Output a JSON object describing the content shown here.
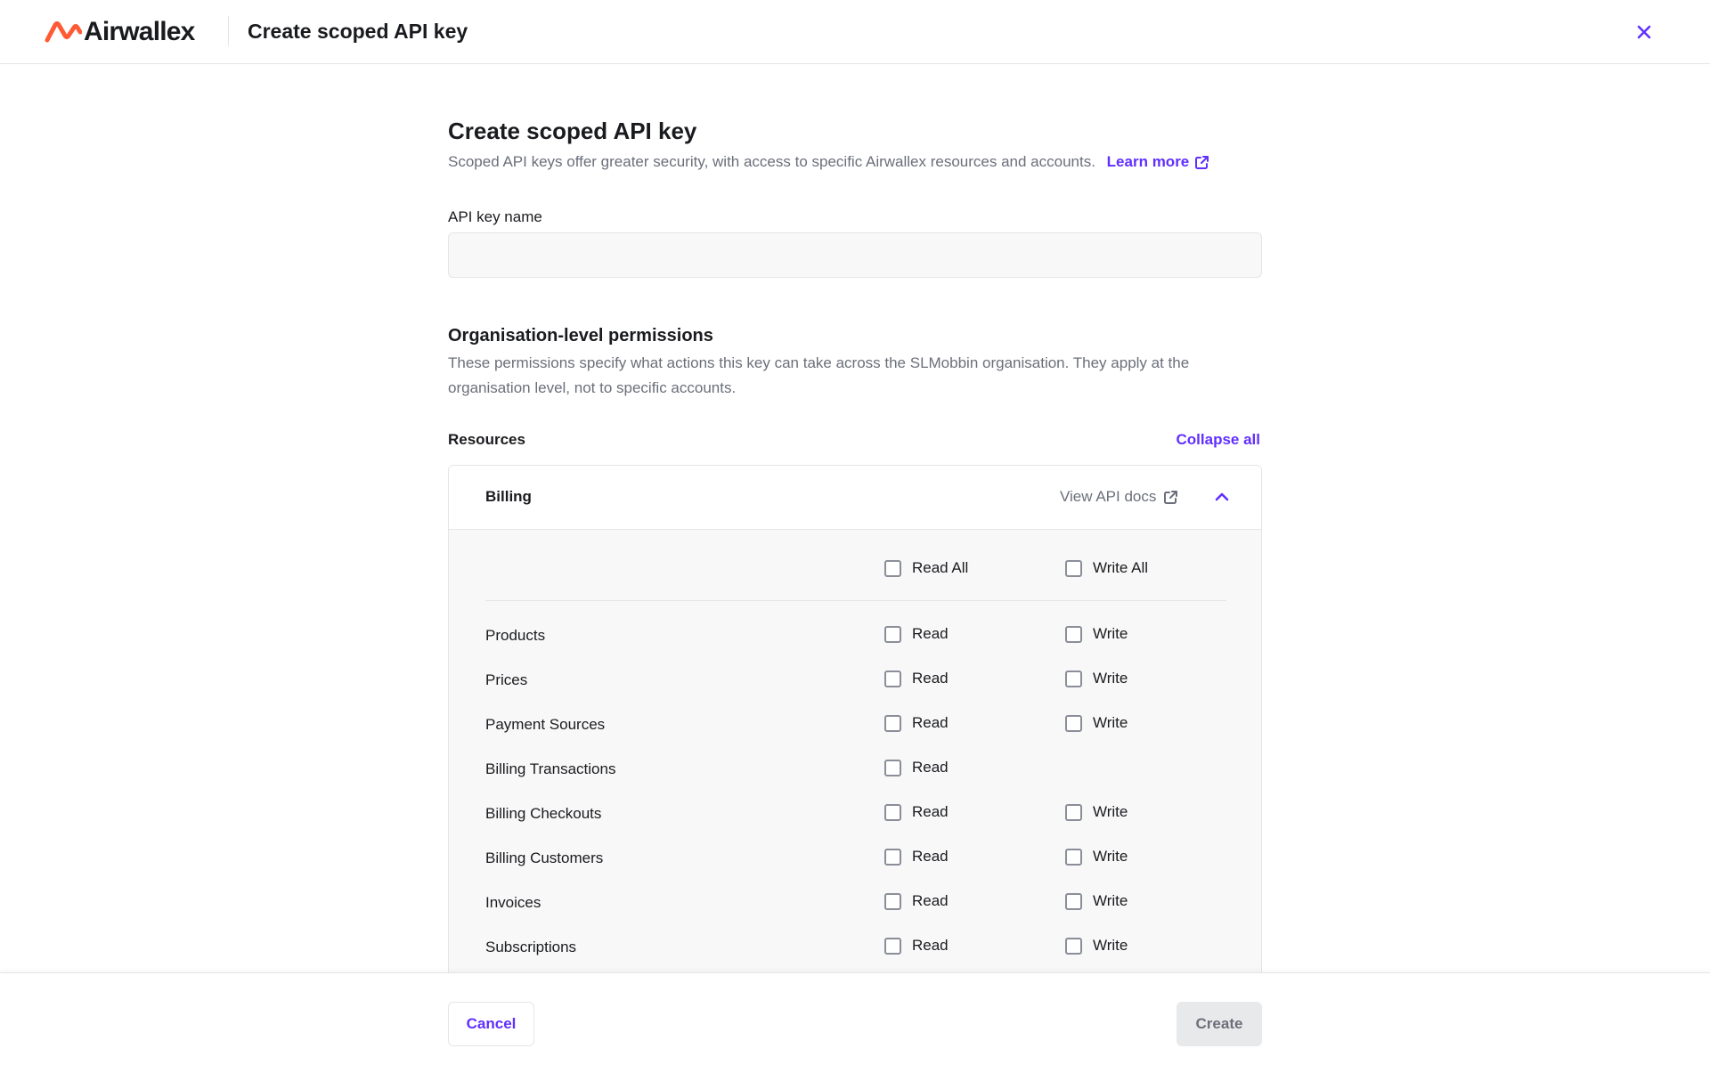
{
  "header": {
    "brand": "Airwallex",
    "title": "Create scoped API key",
    "brand_color": "#ff5a36",
    "accent_color": "#612fff"
  },
  "main": {
    "title": "Create scoped API key",
    "description": "Scoped API keys offer greater security, with access to specific Airwallex resources and accounts.",
    "learn_more": "Learn more",
    "api_key_name_label": "API key name",
    "api_key_name_value": "",
    "org_permissions_title": "Organisation-level permissions",
    "org_permissions_desc": "These permissions specify what actions this key can take across the SLMobbin organisation. They apply at the organisation level, not to specific accounts.",
    "resources_label": "Resources",
    "collapse_all": "Collapse all"
  },
  "billing_panel": {
    "title": "Billing",
    "view_api_docs": "View API docs",
    "read_all": "Read All",
    "write_all": "Write All",
    "rows": [
      {
        "name": "Products",
        "read": "Read",
        "write": "Write"
      },
      {
        "name": "Prices",
        "read": "Read",
        "write": "Write"
      },
      {
        "name": "Payment Sources",
        "read": "Read",
        "write": "Write"
      },
      {
        "name": "Billing Transactions",
        "read": "Read",
        "write": ""
      },
      {
        "name": "Billing Checkouts",
        "read": "Read",
        "write": "Write"
      },
      {
        "name": "Billing Customers",
        "read": "Read",
        "write": "Write"
      },
      {
        "name": "Invoices",
        "read": "Read",
        "write": "Write"
      },
      {
        "name": "Subscriptions",
        "read": "Read",
        "write": "Write"
      }
    ]
  },
  "footer": {
    "cancel": "Cancel",
    "create": "Create"
  }
}
